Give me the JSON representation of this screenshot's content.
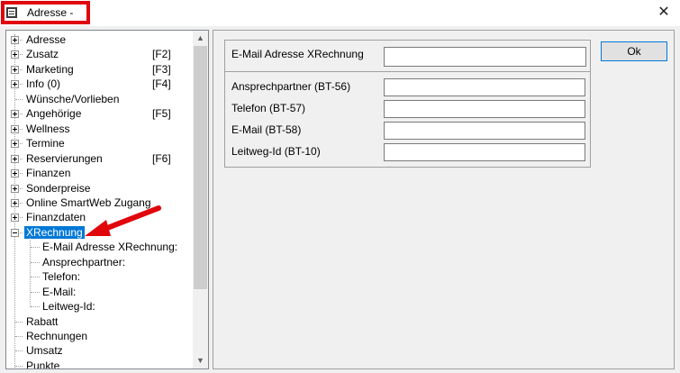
{
  "window": {
    "title": "Adresse -",
    "close_icon": "close-icon",
    "highlight_color": "#e0060b"
  },
  "tree": {
    "items": [
      {
        "label": "Adresse",
        "shortcut": "",
        "expander": "plus"
      },
      {
        "label": "Zusatz",
        "shortcut": "[F2]",
        "expander": "plus"
      },
      {
        "label": "Marketing",
        "shortcut": "[F3]",
        "expander": "plus"
      },
      {
        "label": "Info (0)",
        "shortcut": "[F4]",
        "expander": "plus"
      },
      {
        "label": "Wünsche/Vorlieben",
        "shortcut": "",
        "expander": "none"
      },
      {
        "label": "Angehörige",
        "shortcut": "[F5]",
        "expander": "plus"
      },
      {
        "label": "Wellness",
        "shortcut": "",
        "expander": "plus"
      },
      {
        "label": "Termine",
        "shortcut": "",
        "expander": "plus"
      },
      {
        "label": "Reservierungen",
        "shortcut": "[F6]",
        "expander": "plus"
      },
      {
        "label": "Finanzen",
        "shortcut": "",
        "expander": "plus"
      },
      {
        "label": "Sonderpreise",
        "shortcut": "",
        "expander": "plus"
      },
      {
        "label": "Online SmartWeb Zugang",
        "shortcut": "",
        "expander": "plus"
      },
      {
        "label": "Finanzdaten",
        "shortcut": "",
        "expander": "plus"
      },
      {
        "label": "XRechnung",
        "shortcut": "",
        "expander": "minus",
        "selected": true
      }
    ],
    "children": [
      "E-Mail Adresse XRechnung:",
      "Ansprechpartner:",
      "Telefon:",
      "E-Mail:",
      "Leitweg-Id:"
    ],
    "bottom_items": [
      "Rabatt",
      "Rechnungen",
      "Umsatz",
      "Punkte"
    ],
    "selection_color": "#0078d7",
    "arrow_color": "#e0060b"
  },
  "form": {
    "email_label": "E-Mail Adresse XRechnung",
    "email_value": "",
    "fields": [
      {
        "label": "Ansprechpartner (BT-56)",
        "value": ""
      },
      {
        "label": "Telefon (BT-57)",
        "value": ""
      },
      {
        "label": "E-Mail (BT-58)",
        "value": ""
      },
      {
        "label": "Leitweg-Id (BT-10)",
        "value": ""
      }
    ],
    "ok_label": "Ok"
  }
}
